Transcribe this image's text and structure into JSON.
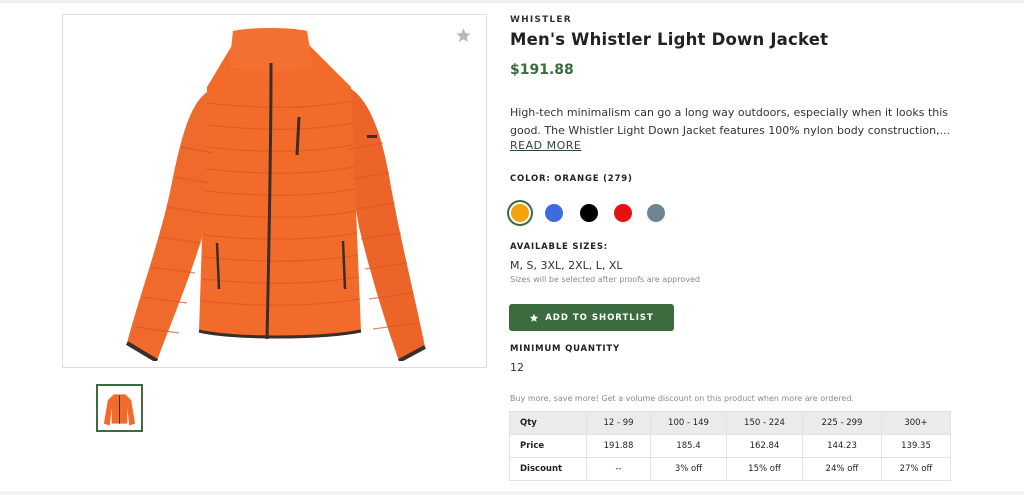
{
  "product": {
    "brand": "WHISTLER",
    "title": "Men's Whistler Light Down Jacket",
    "price": "$191.88",
    "description": "High-tech minimalism can go a long way outdoors, especially when it looks this good. The Whistler Light Down Jacket features 100% nylon body construction,...",
    "read_more": "READ MORE",
    "favorite_icon": "star-icon"
  },
  "colors": {
    "label": "COLOR: ORANGE (279)",
    "swatches": [
      {
        "name": "orange",
        "hex": "#f5a20a",
        "selected": true
      },
      {
        "name": "blue",
        "hex": "#3e6be0",
        "selected": false
      },
      {
        "name": "black",
        "hex": "#000000",
        "selected": false
      },
      {
        "name": "red",
        "hex": "#ea1010",
        "selected": false
      },
      {
        "name": "grey",
        "hex": "#6f8691",
        "selected": false
      }
    ]
  },
  "sizes": {
    "label": "AVAILABLE SIZES:",
    "values": "M, S, 3XL, 2XL, L, XL",
    "note": "Sizes will be selected after proofs are approved"
  },
  "actions": {
    "shortlist_label": "ADD TO SHORTLIST"
  },
  "minimum": {
    "label": "MINIMUM QUANTITY",
    "value": "12"
  },
  "volume": {
    "note": "Buy more, save more! Get a volume discount on this product when more are ordered.",
    "headers": [
      "Qty",
      "12 - 99",
      "100 - 149",
      "150 - 224",
      "225 - 299",
      "300+"
    ],
    "rows": [
      [
        "Price",
        "191.88",
        "185.4",
        "162.84",
        "144.23",
        "139.35"
      ],
      [
        "Discount",
        "--",
        "3% off",
        "15% off",
        "24% off",
        "27% off"
      ]
    ]
  },
  "theme": {
    "accent": "#3b6b3e",
    "jacket_color": "#f36b2a"
  }
}
